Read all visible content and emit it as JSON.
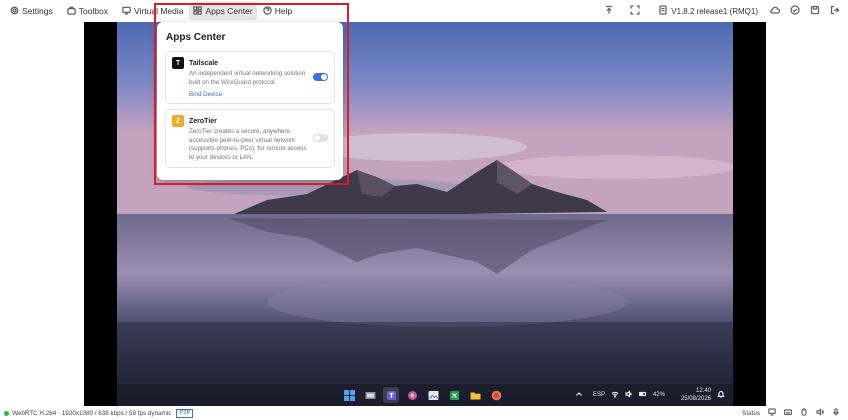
{
  "toolbar": {
    "settings_label": "Settings",
    "toolbox_label": "Toolbox",
    "virtual_media_label": "Virtual Media",
    "apps_center_label": "Apps Center",
    "help_label": "Help",
    "version_label": "V1.8.2 release1 (RMQ1)"
  },
  "popup": {
    "title": "Apps Center",
    "apps": [
      {
        "name": "Tailscale",
        "logo_letter": "T",
        "logo_color": "#111111",
        "description": "An independent virtual networking solution built on the WireGuard protocol.",
        "link": "Bind Device",
        "enabled": true
      },
      {
        "name": "ZeroTier",
        "logo_letter": "Z",
        "logo_color": "#f4a92a",
        "description": "ZeroTier creates a secure, anywhere-accessible peer-to-peer virtual network (supports phones, PCs), for remote access to your devices or LAN.",
        "enabled": false
      }
    ]
  },
  "taskbar": {
    "lang": "ESP",
    "battery": "42%",
    "time": "12:40",
    "date": "25/08/2026"
  },
  "status": {
    "stream_info": "WebRTC H.264 · 1920x1080 / 638 kbps / 59 fps dynamic",
    "p2p_label": "P2P",
    "status_label": "Status",
    "connection_color": "#2fb34a"
  },
  "colors": {
    "accent": "#3f6fd8",
    "highlight": "#d41e2a"
  }
}
